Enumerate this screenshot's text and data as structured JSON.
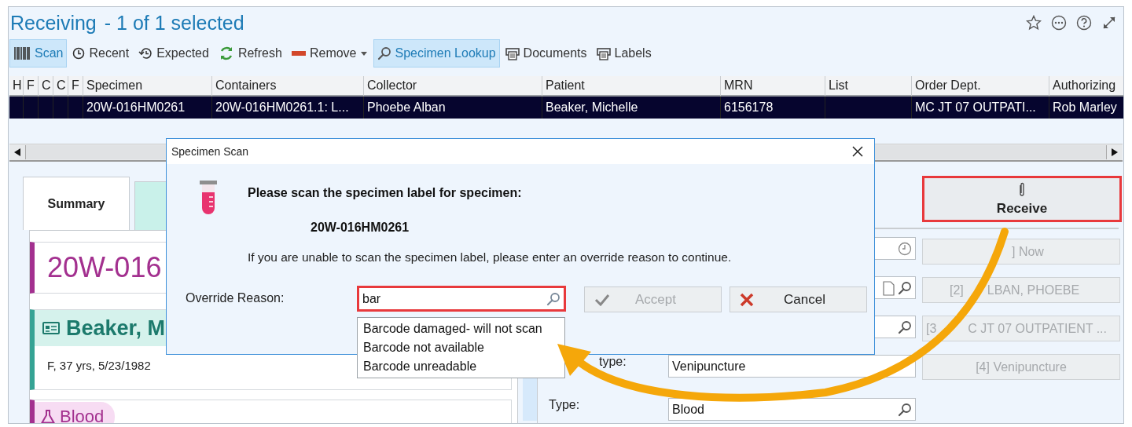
{
  "window": {
    "title": "Receiving",
    "subtitle": "- 1 of 1 selected"
  },
  "toolbar": [
    {
      "label": "Scan",
      "selected": true,
      "has_menu": false
    },
    {
      "label": "Recent",
      "selected": false,
      "has_menu": false
    },
    {
      "label": "Expected",
      "selected": false,
      "has_menu": false
    },
    {
      "label": "Refresh",
      "selected": false,
      "has_menu": false
    },
    {
      "label": "Remove",
      "selected": false,
      "has_menu": true
    },
    {
      "label": "Specimen Lookup",
      "selected": true,
      "has_menu": false
    },
    {
      "label": "Documents",
      "selected": false,
      "has_menu": false
    },
    {
      "label": "Labels",
      "selected": false,
      "has_menu": false
    }
  ],
  "table": {
    "columns": [
      "H",
      "F",
      "C",
      "C",
      "F",
      "Specimen",
      "Containers",
      "Collector",
      "Patient",
      "MRN",
      "List",
      "Order Dept.",
      "Authorizing"
    ],
    "rows": [
      {
        "selected": true,
        "cells": [
          "",
          "",
          "",
          "",
          "",
          "20W-016HM0261",
          "20W-016HM0261.1: L...",
          "Phoebe Alban",
          "Beaker, Michelle",
          "6156178",
          "",
          "MC JT 07 OUTPATI...",
          "Rob Marley"
        ]
      }
    ]
  },
  "tabs": [
    {
      "label": "Summary",
      "selected": true
    },
    {
      "selected": false
    }
  ],
  "cards": [
    {
      "kind": "specimen",
      "title": "20W-016",
      "color": "#a3308f"
    },
    {
      "kind": "patient",
      "name": "Beaker, M",
      "details": "F, 37 yrs, 5/23/1982",
      "color": "#35a394"
    },
    {
      "kind": "sample",
      "label": "Blood",
      "color": "#a3308f"
    }
  ],
  "form": [
    {
      "kind": "time"
    },
    {
      "kind": "document"
    },
    {
      "kind": "lookup"
    },
    {
      "kind": "plain",
      "label": "type:",
      "value": "Venipuncture"
    },
    {
      "kind": "lookup",
      "label": "Type:",
      "value": "Blood"
    }
  ],
  "receive_button": {
    "label": "Receive",
    "highlighted": true
  },
  "quick_buttons": [
    {
      "parts": [
        "] Now"
      ],
      "disabled": true
    },
    {
      "parts": [
        "[2]",
        "LBAN, PHOEBE"
      ],
      "disabled": true
    },
    {
      "parts": [
        "[3",
        "C JT 07 OUTPATIENT ..."
      ],
      "disabled": true
    },
    {
      "parts": [
        "[4] Venipuncture"
      ],
      "disabled": true
    }
  ],
  "dialog": {
    "title": "Specimen Scan",
    "heading": "Please scan the specimen label for specimen:",
    "specimen": "20W-016HM0261",
    "message": "If you are unable to scan the specimen label, please enter an override reason to continue.",
    "override_label": "Override Reason:",
    "override_value": "bar",
    "override_highlighted": true,
    "suggestions": [
      "Barcode damaged- will not scan",
      "Barcode not available",
      "Barcode unreadable"
    ],
    "buttons": [
      {
        "kind": "accept",
        "label": "Accept",
        "disabled": true
      },
      {
        "kind": "cancel",
        "label": "Cancel",
        "disabled": false
      }
    ]
  }
}
